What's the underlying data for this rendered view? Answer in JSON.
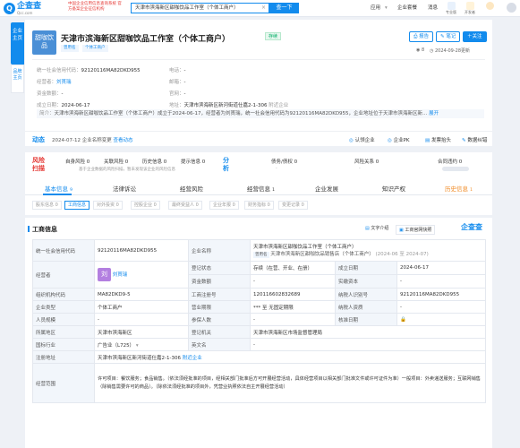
{
  "topbar": {
    "logo_name": "企查查",
    "logo_url": "Qcc.com",
    "slogan": "中国企业信用信息查询系统 官方备案企业征信机构",
    "search_value": "天津市滨海新区甜咖饮品工作室（个体工商户）",
    "search_clear": "×",
    "search_button": "查一下",
    "app_menu": "应用",
    "vip_label": "企业套餐",
    "msg_label": "消息",
    "pro_label": "专业版",
    "user_label": "开发者"
  },
  "side": {
    "tab1": "企业主页",
    "tab2": "品牌主页"
  },
  "header": {
    "logo_text": "甜咖饮品",
    "title": "天津市滨海新区甜咖饮品工作室（个体工商户）",
    "status": "存续",
    "tag1": "曾用名",
    "tag2": "个体工商户",
    "btn_report": "报告",
    "btn_note": "笔记",
    "btn_follow": "关注",
    "views": "8",
    "update": "2024-09-28更新",
    "row1": [
      {
        "label": "统一社会信用代码：",
        "value": "92120116MA82DKD955"
      },
      {
        "label": "电话：",
        "value": "-"
      }
    ],
    "row2": [
      {
        "label": "经营者：",
        "value": "刘貫瑞"
      },
      {
        "label": "邮箱：",
        "value": "-"
      }
    ],
    "row3": [
      {
        "label": "资金数额：",
        "value": "-"
      },
      {
        "label": "官网：",
        "value": "-"
      }
    ],
    "row4": [
      {
        "label": "成立日期：",
        "value": "2024-06-17"
      },
      {
        "label": "地址：",
        "value": "天津市滨海新区新河街道仕嘉2-1-306"
      },
      {
        "label": "",
        "value": "附近企业"
      }
    ],
    "intro_label": "简介：",
    "intro": "天津市滨海新区甜咖饮品工作室（个体工商户）成立于2024-06-17，经营者为刘貫瑞，统一社会信用代码为92120116MA82DKD955，企业地址位于天津市滨海新区新...",
    "intro_more": "展开"
  },
  "dynamic": {
    "label": "动态",
    "text": "2024-07-12 企业名称变更",
    "link": "查看动态",
    "links": [
      "认领企业",
      "企业PK",
      "发票抬头",
      "数据纠错"
    ]
  },
  "risk": {
    "title": "风险扫描",
    "items": [
      {
        "label": "自身风险",
        "value": "0"
      },
      {
        "label": "关联风险",
        "value": "0"
      },
      {
        "label": "历史信息",
        "value": "0"
      },
      {
        "label": "提示信息",
        "value": "0"
      }
    ],
    "sub": "基于企业数据的风险扫描，暂未发现该企业的风险信息",
    "analyze_title": "分析",
    "analyze_items": [
      {
        "label": "债务/债权",
        "value": "0"
      },
      {
        "label": "风险关系",
        "value": "0"
      },
      {
        "label": "合同违约",
        "value": "0"
      }
    ],
    "analyze_sub": "-"
  },
  "tabs": [
    {
      "label": "基本信息",
      "count": "9"
    },
    {
      "label": "法律诉讼",
      "count": ""
    },
    {
      "label": "经营风险",
      "count": ""
    },
    {
      "label": "经营信息",
      "count": "1"
    },
    {
      "label": "企业发展",
      "count": ""
    },
    {
      "label": "知识产权",
      "count": ""
    },
    {
      "label": "历史信息",
      "count": "1"
    }
  ],
  "subtabs": [
    {
      "label": "股东信息 0"
    },
    {
      "label": "工商信息"
    },
    {
      "label": "对外投资 0"
    },
    {
      "label": "控股企业 0"
    },
    {
      "label": "最终受益人 0"
    },
    {
      "label": "企业年报 0"
    },
    {
      "label": "财务指标 0"
    },
    {
      "label": "变更记录 0"
    }
  ],
  "biz": {
    "title": "工商信息",
    "tool1": "文字介绍",
    "tool2": "工商官网快照",
    "logo": "企查查",
    "name_label": "企业名称",
    "name_value": "天津市滨海新区甜咖饮品工作室（个体工商户）",
    "name_tag": "曾用名",
    "former_name": "天津市滨海新区甜咖饮品销售店（个体工商户）",
    "former_date": "(2024-06 至 2024-07)",
    "credit_label": "统一社会信用代码",
    "credit_value": "92120116MA82DKD955",
    "operator_label": "经营者",
    "operator_avatar": "刘",
    "operator_name": "刘貫瑞",
    "status_label": "登记状态",
    "status_value": "存续（在营、开业、在册）",
    "date_label": "成立日期",
    "date_value": "2024-06-17",
    "capital_label": "资金数额",
    "capital_value": "-",
    "paid_label": "实缴资本",
    "paid_value": "-",
    "org_label": "组织机构代码",
    "org_value": "MA82DKD9-5",
    "reg_label": "工商注册号",
    "reg_value": "120116602832689",
    "tax_label": "纳税人识别号",
    "tax_value": "92120116MA82DKD955",
    "type_label": "企业类型",
    "type_value": "个体工商户",
    "term_label": "营业期限",
    "term_value": "*** 至 无固定期限",
    "qual_label": "纳税人资质",
    "qual_value": "-",
    "staff_label": "人员规模",
    "staff_value": "-",
    "insured_label": "参保人数",
    "insured_value": "-",
    "approve_label": "核准日期",
    "approve_value": "",
    "region_label": "所属地区",
    "region_value": "天津市滨海新区",
    "authority_label": "登记机关",
    "authority_value": "天津市滨海新区市场监督管理局",
    "industry_label": "国标行业",
    "industry_value": "广告业（L725）",
    "en_label": "英文名",
    "en_value": "-",
    "addr_label": "注册地址",
    "addr_value": "天津市滨海新区新河街道仕嘉2-1-306",
    "addr_link": "附近企业",
    "scope_label": "经营范围",
    "scope_value": "许可项目：餐饮服务；食品销售。（依法须经批准的项目，经相关部门批准后方可开展经营活动，具体经营项目以相关部门批准文件或许可证件为准）一般项目：外卖递送服务；互联网销售（除销售需要许可的商品）。（除依法须经批准的项目外，凭营业执照依法自主开展经营活动）"
  },
  "colors": {
    "brand": "#128bed",
    "risk": "#e53935",
    "status_green": "#00ad65"
  }
}
